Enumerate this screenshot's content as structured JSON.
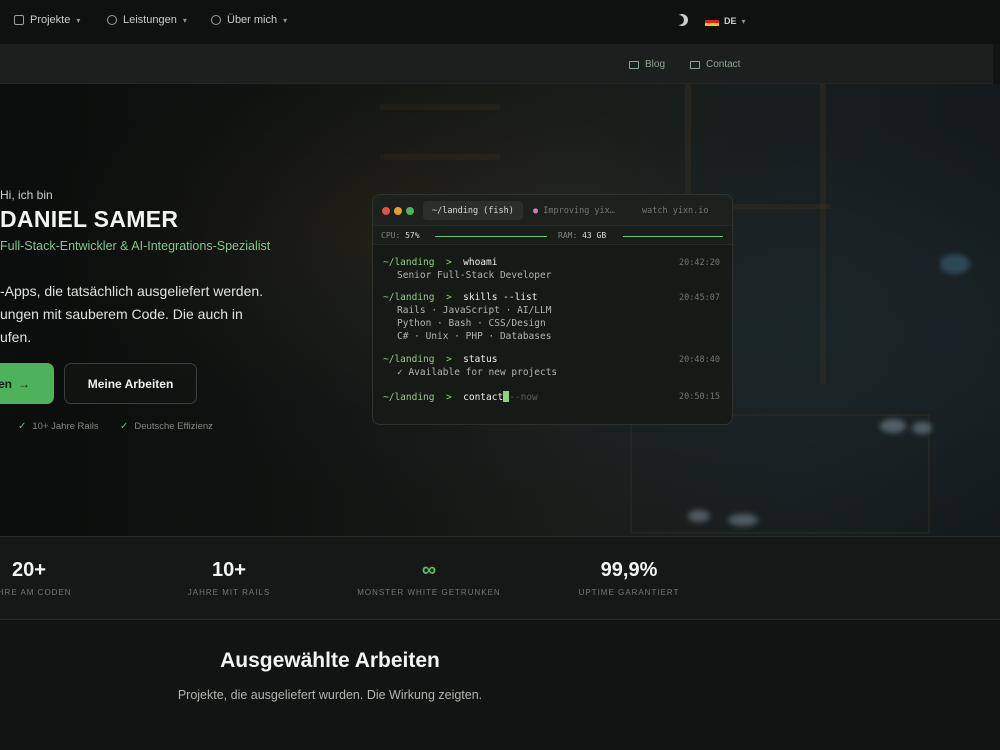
{
  "nav": {
    "items": [
      {
        "label": "Projekte",
        "icon": "folder-icon"
      },
      {
        "label": "Leistungen",
        "icon": "gear-icon"
      },
      {
        "label": "Über mich",
        "icon": "user-icon"
      }
    ],
    "lang": "DE"
  },
  "subnav": {
    "blog": "Blog",
    "contact": "Contact"
  },
  "hero": {
    "greeting": "Hi, ich bin",
    "name": "DANIEL SAMER",
    "role": "Full-Stack-Entwickler & AI-Integrations-Spezialist",
    "tagline_1": "-Apps, die tatsächlich ausgeliefert werden.",
    "tagline_2": "ungen mit sauberem Code. Die auch in",
    "tagline_3": "ufen.",
    "primary_cta": "en",
    "primary_arrow": "→",
    "secondary_cta": "Meine Arbeiten",
    "checks": [
      "10+ Jahre Rails",
      "Deutsche Effizienz"
    ]
  },
  "terminal": {
    "tab_active": "~/landing (fish)",
    "tab_2": "Improving yix…",
    "tab_3": "watch yixn.io",
    "cpu_label": "CPU:",
    "cpu_value": "57%",
    "ram_label": "RAM:",
    "ram_value": "43 GB",
    "prompt": "~/landing",
    "arrow": ">",
    "entries": [
      {
        "cmd": "whoami",
        "time": "20:42:20",
        "output": [
          "Senior Full-Stack Developer"
        ]
      },
      {
        "cmd": "skills --list",
        "time": "20:45:07",
        "output": [
          "Rails · JavaScript · AI/LLM",
          "Python · Bash · CSS/Design",
          "C# · Unix · PHP · Databases"
        ]
      },
      {
        "cmd": "status",
        "time": "20:48:40",
        "output": [
          "✓ Available for new projects"
        ]
      },
      {
        "cmd": "contact",
        "time": "20:50:15",
        "suggestion": "--now"
      }
    ]
  },
  "stats": [
    {
      "value": "20+",
      "label": "JAHRE AM CODEN"
    },
    {
      "value": "10+",
      "label": "JAHRE MIT RAILS"
    },
    {
      "value": "∞",
      "label": "MONSTER WHITE GETRUNKEN"
    },
    {
      "value": "99,9%",
      "label": "UPTIME GARANTIERT"
    }
  ],
  "featured": {
    "title": "Ausgewählte Arbeiten",
    "subtitle": "Projekte, die ausgeliefert wurden. Die Wirkung zeigten."
  },
  "colors": {
    "accent": "#4cb35c",
    "background": "#111412",
    "terminal_green": "#8fd17b"
  }
}
